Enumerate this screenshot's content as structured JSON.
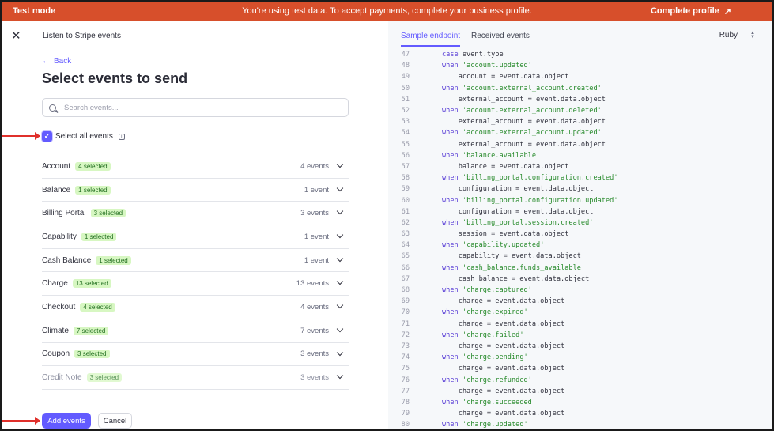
{
  "banner": {
    "mode": "Test mode",
    "message": "You're using test data. To accept payments, complete your business profile.",
    "cta": "Complete profile",
    "cta_icon": "arrow-up-right-icon",
    "color": "#d74f2b"
  },
  "header": {
    "title": "Listen to Stripe events"
  },
  "back_label": "Back",
  "page_title": "Select events to send",
  "search": {
    "placeholder": "Search events..."
  },
  "select_all": {
    "label": "Select all events",
    "checked": true
  },
  "events": [
    {
      "name": "Account",
      "badge": "4 selected",
      "count": "4 events"
    },
    {
      "name": "Balance",
      "badge": "1 selected",
      "count": "1 event"
    },
    {
      "name": "Billing Portal",
      "badge": "3 selected",
      "count": "3 events"
    },
    {
      "name": "Capability",
      "badge": "1 selected",
      "count": "1 event"
    },
    {
      "name": "Cash Balance",
      "badge": "1 selected",
      "count": "1 event"
    },
    {
      "name": "Charge",
      "badge": "13 selected",
      "count": "13 events"
    },
    {
      "name": "Checkout",
      "badge": "4 selected",
      "count": "4 events"
    },
    {
      "name": "Climate",
      "badge": "7 selected",
      "count": "7 events"
    },
    {
      "name": "Coupon",
      "badge": "3 selected",
      "count": "3 events"
    },
    {
      "name": "Credit Note",
      "badge": "3 selected",
      "count": "3 events"
    }
  ],
  "buttons": {
    "add": "Add events",
    "cancel": "Cancel"
  },
  "accent_color": "#635bff",
  "tabs": [
    {
      "label": "Sample endpoint",
      "active": true
    },
    {
      "label": "Received events",
      "active": false
    }
  ],
  "language": "Ruby",
  "code_lines": [
    {
      "n": "47",
      "indent": "",
      "kw": "case",
      "rest": " event.type",
      "str": ""
    },
    {
      "n": "48",
      "indent": "",
      "kw": "when",
      "rest": " ",
      "str": "'account.updated'"
    },
    {
      "n": "49",
      "indent": "    ",
      "kw": "",
      "rest": "account = event.data.object",
      "str": ""
    },
    {
      "n": "50",
      "indent": "",
      "kw": "when",
      "rest": " ",
      "str": "'account.external_account.created'"
    },
    {
      "n": "51",
      "indent": "    ",
      "kw": "",
      "rest": "external_account = event.data.object",
      "str": ""
    },
    {
      "n": "52",
      "indent": "",
      "kw": "when",
      "rest": " ",
      "str": "'account.external_account.deleted'"
    },
    {
      "n": "53",
      "indent": "    ",
      "kw": "",
      "rest": "external_account = event.data.object",
      "str": ""
    },
    {
      "n": "54",
      "indent": "",
      "kw": "when",
      "rest": " ",
      "str": "'account.external_account.updated'"
    },
    {
      "n": "55",
      "indent": "    ",
      "kw": "",
      "rest": "external_account = event.data.object",
      "str": ""
    },
    {
      "n": "56",
      "indent": "",
      "kw": "when",
      "rest": " ",
      "str": "'balance.available'"
    },
    {
      "n": "57",
      "indent": "    ",
      "kw": "",
      "rest": "balance = event.data.object",
      "str": ""
    },
    {
      "n": "58",
      "indent": "",
      "kw": "when",
      "rest": " ",
      "str": "'billing_portal.configuration.created'"
    },
    {
      "n": "59",
      "indent": "    ",
      "kw": "",
      "rest": "configuration = event.data.object",
      "str": ""
    },
    {
      "n": "60",
      "indent": "",
      "kw": "when",
      "rest": " ",
      "str": "'billing_portal.configuration.updated'"
    },
    {
      "n": "61",
      "indent": "    ",
      "kw": "",
      "rest": "configuration = event.data.object",
      "str": ""
    },
    {
      "n": "62",
      "indent": "",
      "kw": "when",
      "rest": " ",
      "str": "'billing_portal.session.created'"
    },
    {
      "n": "63",
      "indent": "    ",
      "kw": "",
      "rest": "session = event.data.object",
      "str": ""
    },
    {
      "n": "64",
      "indent": "",
      "kw": "when",
      "rest": " ",
      "str": "'capability.updated'"
    },
    {
      "n": "65",
      "indent": "    ",
      "kw": "",
      "rest": "capability = event.data.object",
      "str": ""
    },
    {
      "n": "66",
      "indent": "",
      "kw": "when",
      "rest": " ",
      "str": "'cash_balance.funds_available'"
    },
    {
      "n": "67",
      "indent": "    ",
      "kw": "",
      "rest": "cash_balance = event.data.object",
      "str": ""
    },
    {
      "n": "68",
      "indent": "",
      "kw": "when",
      "rest": " ",
      "str": "'charge.captured'"
    },
    {
      "n": "69",
      "indent": "    ",
      "kw": "",
      "rest": "charge = event.data.object",
      "str": ""
    },
    {
      "n": "70",
      "indent": "",
      "kw": "when",
      "rest": " ",
      "str": "'charge.expired'"
    },
    {
      "n": "71",
      "indent": "    ",
      "kw": "",
      "rest": "charge = event.data.object",
      "str": ""
    },
    {
      "n": "72",
      "indent": "",
      "kw": "when",
      "rest": " ",
      "str": "'charge.failed'"
    },
    {
      "n": "73",
      "indent": "    ",
      "kw": "",
      "rest": "charge = event.data.object",
      "str": ""
    },
    {
      "n": "74",
      "indent": "",
      "kw": "when",
      "rest": " ",
      "str": "'charge.pending'"
    },
    {
      "n": "75",
      "indent": "    ",
      "kw": "",
      "rest": "charge = event.data.object",
      "str": ""
    },
    {
      "n": "76",
      "indent": "",
      "kw": "when",
      "rest": " ",
      "str": "'charge.refunded'"
    },
    {
      "n": "77",
      "indent": "    ",
      "kw": "",
      "rest": "charge = event.data.object",
      "str": ""
    },
    {
      "n": "78",
      "indent": "",
      "kw": "when",
      "rest": " ",
      "str": "'charge.succeeded'"
    },
    {
      "n": "79",
      "indent": "    ",
      "kw": "",
      "rest": "charge = event.data.object",
      "str": ""
    },
    {
      "n": "80",
      "indent": "",
      "kw": "when",
      "rest": " ",
      "str": "'charge.updated'"
    }
  ]
}
